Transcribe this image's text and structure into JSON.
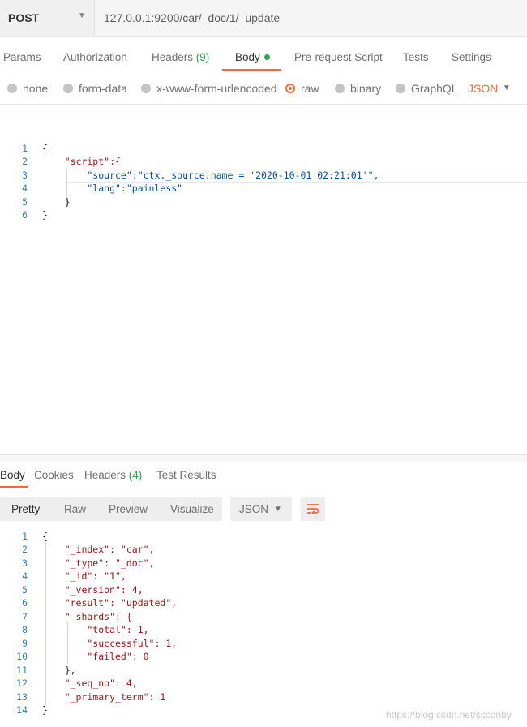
{
  "request": {
    "method": "POST",
    "url": "127.0.0.1:9200/car/_doc/1/_update",
    "tabs": [
      {
        "label": "Params"
      },
      {
        "label": "Authorization"
      },
      {
        "label": "Headers",
        "count": "(9)"
      },
      {
        "label": "Body"
      },
      {
        "label": "Pre-request Script"
      },
      {
        "label": "Tests"
      },
      {
        "label": "Settings"
      }
    ],
    "active_tab": "Body",
    "body_types": [
      "none",
      "form-data",
      "x-www-form-urlencoded",
      "raw",
      "binary",
      "GraphQL"
    ],
    "selected_body_type": "raw",
    "language": "JSON",
    "code_line_numbers": [
      "1",
      "2",
      "3",
      "4",
      "5",
      "6"
    ],
    "code_lines": [
      "{",
      "    \"script\":{",
      "        \"source\":\"ctx._source.name = '2020-10-01 02:21:01'\",",
      "        \"lang\":\"painless\"",
      "    }",
      "}"
    ]
  },
  "response": {
    "tabs": [
      {
        "label": "Body"
      },
      {
        "label": "Cookies"
      },
      {
        "label": "Headers",
        "count": "(4)"
      },
      {
        "label": "Test Results"
      }
    ],
    "active_tab": "Body",
    "view_modes": [
      "Pretty",
      "Raw",
      "Preview",
      "Visualize"
    ],
    "active_view": "Pretty",
    "format": "JSON",
    "code_line_numbers": [
      "1",
      "2",
      "3",
      "4",
      "5",
      "6",
      "7",
      "8",
      "9",
      "10",
      "11",
      "12",
      "13",
      "14"
    ],
    "code_lines": [
      "{",
      "    \"_index\": \"car\",",
      "    \"_type\": \"_doc\",",
      "    \"_id\": \"1\",",
      "    \"_version\": 4,",
      "    \"result\": \"updated\",",
      "    \"_shards\": {",
      "        \"total\": 1,",
      "        \"successful\": 1,",
      "        \"failed\": 0",
      "    },",
      "    \"_seq_no\": 4,",
      "    \"_primary_term\": 1",
      "}"
    ]
  },
  "watermark": "https://blog.csdn.net/sccdnby",
  "colors": {
    "accent": "#f26b3a",
    "count": "#27a844",
    "line_number": "#2f7fbf"
  },
  "icons": [
    "chevron-down-icon",
    "radio-icon",
    "green-dot-icon",
    "wrap-lines-icon"
  ]
}
